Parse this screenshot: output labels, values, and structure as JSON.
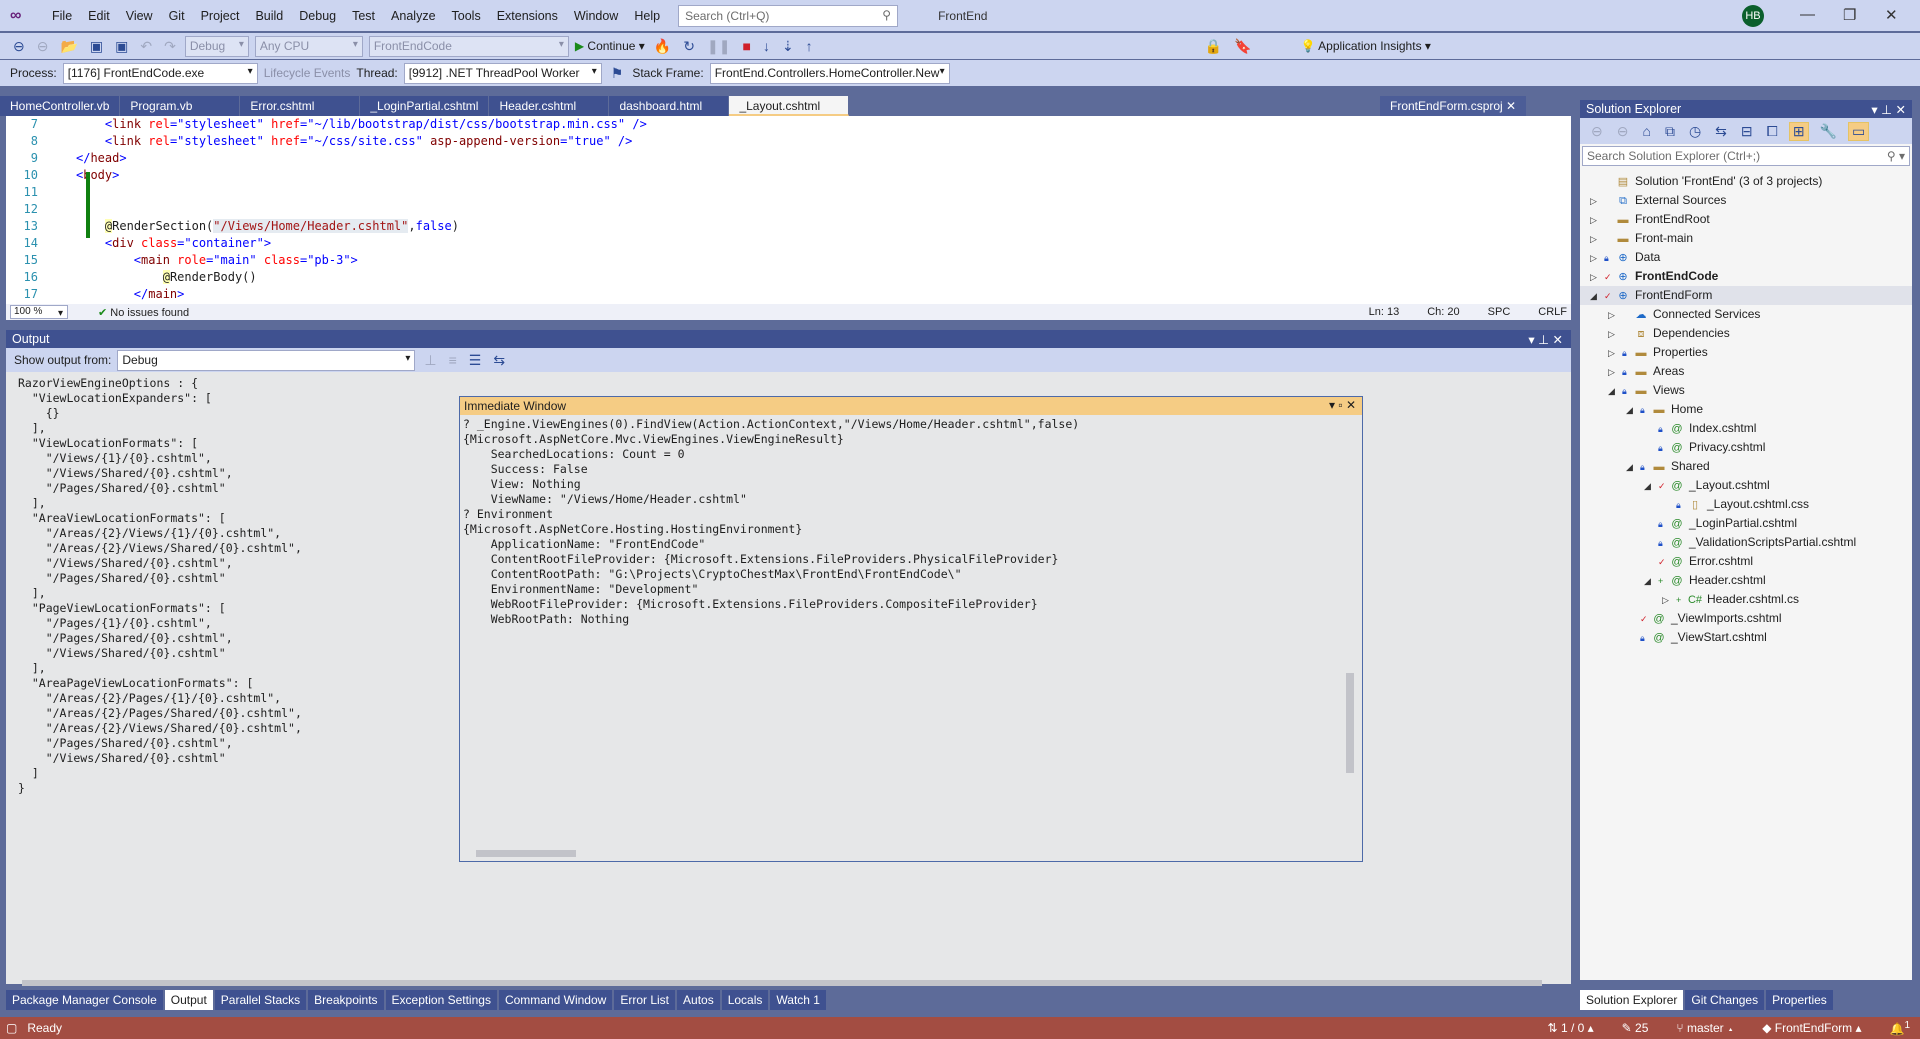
{
  "menubar": {
    "items": [
      "File",
      "Edit",
      "View",
      "Git",
      "Project",
      "Build",
      "Debug",
      "Test",
      "Analyze",
      "Tools",
      "Extensions",
      "Window",
      "Help"
    ],
    "search_placeholder": "Search (Ctrl+Q)",
    "window_title": "FrontEnd",
    "avatar": "HB"
  },
  "toolbar": {
    "config": "Debug",
    "platform": "Any CPU",
    "startup": "FrontEndCode",
    "continue": "Continue",
    "app_insights": "Application Insights"
  },
  "debugbar": {
    "process_label": "Process:",
    "process": "[1176] FrontEndCode.exe",
    "lifecycle": "Lifecycle Events",
    "thread_label": "Thread:",
    "thread": "[9912] .NET ThreadPool Worker",
    "stack_label": "Stack Frame:",
    "stack": "FrontEnd.Controllers.HomeController.New"
  },
  "doc_tabs": [
    "HomeController.vb",
    "Program.vb",
    "Error.cshtml",
    "_LoginPartial.cshtml",
    "Header.cshtml",
    "dashboard.html",
    "_Layout.cshtml"
  ],
  "doc_tab_right": "FrontEndForm.csproj",
  "editor": {
    "lines": [
      {
        "n": "7",
        "tokens": [
          {
            "t": "    ",
            "c": "def"
          },
          {
            "t": "<",
            "c": "br"
          },
          {
            "t": "link ",
            "c": "tag"
          },
          {
            "t": "rel",
            "c": "at"
          },
          {
            "t": "=\"stylesheet\" ",
            "c": "str"
          },
          {
            "t": "href",
            "c": "at"
          },
          {
            "t": "=\"~/lib/bootstrap/dist/css/bootstrap.min.css\" />",
            "c": "str"
          }
        ]
      },
      {
        "n": "8",
        "tokens": [
          {
            "t": "    ",
            "c": "def"
          },
          {
            "t": "<",
            "c": "br"
          },
          {
            "t": "link ",
            "c": "tag"
          },
          {
            "t": "rel",
            "c": "at"
          },
          {
            "t": "=\"stylesheet\" ",
            "c": "str"
          },
          {
            "t": "href",
            "c": "at"
          },
          {
            "t": "=\"~/css/site.css\" ",
            "c": "str"
          },
          {
            "t": "asp-append-version",
            "c": "tag"
          },
          {
            "t": "=\"true\" />",
            "c": "str"
          }
        ]
      },
      {
        "n": "9",
        "tokens": [
          {
            "t": "</",
            "c": "br"
          },
          {
            "t": "head",
            "c": "tag"
          },
          {
            "t": ">",
            "c": "br"
          }
        ]
      },
      {
        "n": "10",
        "tokens": [
          {
            "t": "<",
            "c": "br"
          },
          {
            "t": "body",
            "c": "tag"
          },
          {
            "t": ">",
            "c": "br"
          }
        ]
      },
      {
        "n": "11",
        "tokens": []
      },
      {
        "n": "12",
        "tokens": []
      },
      {
        "n": "13",
        "tokens": [
          {
            "t": "    ",
            "c": "def"
          },
          {
            "t": "@",
            "c": "rz"
          },
          {
            "t": "RenderSection(",
            "c": "def"
          },
          {
            "t": "\"/Views/Home/Header.cshtml\"",
            "c": "hl"
          },
          {
            "t": ",",
            "c": "def"
          },
          {
            "t": "false",
            "c": "kw"
          },
          {
            "t": ")",
            "c": "def"
          }
        ]
      },
      {
        "n": "14",
        "tokens": [
          {
            "t": "    ",
            "c": "def"
          },
          {
            "t": "<",
            "c": "br"
          },
          {
            "t": "div ",
            "c": "tag"
          },
          {
            "t": "class",
            "c": "at"
          },
          {
            "t": "=\"container\">",
            "c": "str"
          }
        ]
      },
      {
        "n": "15",
        "tokens": [
          {
            "t": "        ",
            "c": "def"
          },
          {
            "t": "<",
            "c": "br"
          },
          {
            "t": "main ",
            "c": "tag"
          },
          {
            "t": "role",
            "c": "at"
          },
          {
            "t": "=\"main\" ",
            "c": "str"
          },
          {
            "t": "class",
            "c": "at"
          },
          {
            "t": "=\"pb-3\">",
            "c": "str"
          }
        ]
      },
      {
        "n": "16",
        "tokens": [
          {
            "t": "            ",
            "c": "def"
          },
          {
            "t": "@",
            "c": "rz"
          },
          {
            "t": "RenderBody()",
            "c": "def"
          }
        ]
      },
      {
        "n": "17",
        "tokens": [
          {
            "t": "        ",
            "c": "def"
          },
          {
            "t": "</",
            "c": "br"
          },
          {
            "t": "main",
            "c": "tag"
          },
          {
            "t": ">",
            "c": "br"
          }
        ]
      }
    ],
    "zoom": "100 %",
    "issues": "No issues found",
    "ln": "Ln: 13",
    "ch": "Ch: 20",
    "spc": "SPC",
    "crlf": "CRLF"
  },
  "output": {
    "title": "Output",
    "show_from_label": "Show output from:",
    "source": "Debug",
    "lines": [
      "RazorViewEngineOptions : {",
      "  \"ViewLocationExpanders\": [",
      "    {}",
      "  ],",
      "  \"ViewLocationFormats\": [",
      "    \"/Views/{1}/{0}.cshtml\",",
      "    \"/Views/Shared/{0}.cshtml\",",
      "    \"/Pages/Shared/{0}.cshtml\"",
      "  ],",
      "  \"AreaViewLocationFormats\": [",
      "    \"/Areas/{2}/Views/{1}/{0}.cshtml\",",
      "    \"/Areas/{2}/Views/Shared/{0}.cshtml\",",
      "    \"/Views/Shared/{0}.cshtml\",",
      "    \"/Pages/Shared/{0}.cshtml\"",
      "  ],",
      "  \"PageViewLocationFormats\": [",
      "    \"/Pages/{1}/{0}.cshtml\",",
      "    \"/Pages/Shared/{0}.cshtml\",",
      "    \"/Views/Shared/{0}.cshtml\"",
      "  ],",
      "  \"AreaPageViewLocationFormats\": [",
      "    \"/Areas/{2}/Pages/{1}/{0}.cshtml\",",
      "    \"/Areas/{2}/Pages/Shared/{0}.cshtml\",",
      "    \"/Areas/{2}/Views/Shared/{0}.cshtml\",",
      "    \"/Pages/Shared/{0}.cshtml\",",
      "    \"/Views/Shared/{0}.cshtml\"",
      "  ]",
      "}"
    ]
  },
  "immediate": {
    "title": "Immediate Window",
    "lines": [
      "? _Engine.ViewEngines(0).FindView(Action.ActionContext,\"/Views/Home/Header.cshtml\",false)",
      "{Microsoft.AspNetCore.Mvc.ViewEngines.ViewEngineResult}",
      "    SearchedLocations: Count = 0",
      "    Success: False",
      "    View: Nothing",
      "    ViewName: \"/Views/Home/Header.cshtml\"",
      "? Environment",
      "{Microsoft.AspNetCore.Hosting.HostingEnvironment}",
      "    ApplicationName: \"FrontEndCode\"",
      "    ContentRootFileProvider: {Microsoft.Extensions.FileProviders.PhysicalFileProvider}",
      "    ContentRootPath: \"G:\\Projects\\CryptoChestMax\\FrontEnd\\FrontEndCode\\\"",
      "    EnvironmentName: \"Development\"",
      "    WebRootFileProvider: {Microsoft.Extensions.FileProviders.CompositeFileProvider}",
      "    WebRootPath: Nothing"
    ]
  },
  "solution_explorer": {
    "title": "Solution Explorer",
    "search_placeholder": "Search Solution Explorer (Ctrl+;)",
    "items": [
      {
        "label": "Solution 'FrontEnd' (3 of 3 projects)",
        "depth": 0,
        "arrow": "",
        "state": "",
        "icon": "solution-icon"
      },
      {
        "label": "External Sources",
        "depth": 0,
        "arrow": "collapsed",
        "state": "",
        "icon": "external-icon"
      },
      {
        "label": "FrontEndRoot",
        "depth": 0,
        "arrow": "collapsed",
        "state": "",
        "icon": "folder-icon"
      },
      {
        "label": "Front-main",
        "depth": 0,
        "arrow": "collapsed",
        "state": "",
        "icon": "folder-icon"
      },
      {
        "label": "Data",
        "depth": 0,
        "arrow": "collapsed",
        "state": "lock",
        "icon": "web-project-icon"
      },
      {
        "label": "FrontEndCode",
        "depth": 0,
        "arrow": "collapsed",
        "state": "chk",
        "icon": "web-project-icon",
        "bold": true
      },
      {
        "label": "FrontEndForm",
        "depth": 0,
        "arrow": "expanded",
        "state": "chk",
        "icon": "web-project-icon",
        "selected": true
      },
      {
        "label": "Connected Services",
        "depth": 1,
        "arrow": "collapsed",
        "state": "",
        "icon": "cloud-icon"
      },
      {
        "label": "Dependencies",
        "depth": 1,
        "arrow": "collapsed",
        "state": "",
        "icon": "dependencies-icon"
      },
      {
        "label": "Properties",
        "depth": 1,
        "arrow": "collapsed",
        "state": "lock",
        "icon": "properties-folder-icon"
      },
      {
        "label": "Areas",
        "depth": 1,
        "arrow": "collapsed",
        "state": "lock",
        "icon": "folder-icon"
      },
      {
        "label": "Views",
        "depth": 1,
        "arrow": "expanded",
        "state": "lock",
        "icon": "folder-icon"
      },
      {
        "label": "Home",
        "depth": 2,
        "arrow": "expanded",
        "state": "lock",
        "icon": "folder-icon"
      },
      {
        "label": "Index.cshtml",
        "depth": 3,
        "arrow": "",
        "state": "lock",
        "icon": "razor-icon"
      },
      {
        "label": "Privacy.cshtml",
        "depth": 3,
        "arrow": "",
        "state": "lock",
        "icon": "razor-icon"
      },
      {
        "label": "Shared",
        "depth": 2,
        "arrow": "expanded",
        "state": "lock",
        "icon": "folder-icon"
      },
      {
        "label": "_Layout.cshtml",
        "depth": 3,
        "arrow": "expanded",
        "state": "chk",
        "icon": "razor-icon"
      },
      {
        "label": "_Layout.cshtml.css",
        "depth": 4,
        "arrow": "",
        "state": "lock",
        "icon": "css-icon"
      },
      {
        "label": "_LoginPartial.cshtml",
        "depth": 3,
        "arrow": "",
        "state": "lock",
        "icon": "razor-icon"
      },
      {
        "label": "_ValidationScriptsPartial.cshtml",
        "depth": 3,
        "arrow": "",
        "state": "lock",
        "icon": "razor-icon"
      },
      {
        "label": "Error.cshtml",
        "depth": 3,
        "arrow": "",
        "state": "chk",
        "icon": "razor-icon"
      },
      {
        "label": "Header.cshtml",
        "depth": 3,
        "arrow": "expanded",
        "state": "add",
        "icon": "razor-icon"
      },
      {
        "label": "Header.cshtml.cs",
        "depth": 4,
        "arrow": "collapsed",
        "state": "add",
        "icon": "csharp-icon"
      },
      {
        "label": "_ViewImports.cshtml",
        "depth": 2,
        "arrow": "",
        "state": "chk",
        "icon": "razor-icon"
      },
      {
        "label": "_ViewStart.cshtml",
        "depth": 2,
        "arrow": "",
        "state": "lock",
        "icon": "razor-icon"
      }
    ]
  },
  "bottom_tabs": [
    "Package Manager Console",
    "Output",
    "Parallel Stacks",
    "Breakpoints",
    "Exception Settings",
    "Command Window",
    "Error List",
    "Autos",
    "Locals",
    "Watch 1"
  ],
  "right_tabs": [
    "Solution Explorer",
    "Git Changes",
    "Properties"
  ],
  "status": {
    "ready": "Ready",
    "sync": "1 / 0",
    "changes": "25",
    "branch": "master",
    "repo": "FrontEndForm",
    "notifications": "1"
  },
  "colors": {
    "accent": "#3f5190",
    "statusbar": "#a34d42",
    "immediate_header": "#f5cc84"
  }
}
